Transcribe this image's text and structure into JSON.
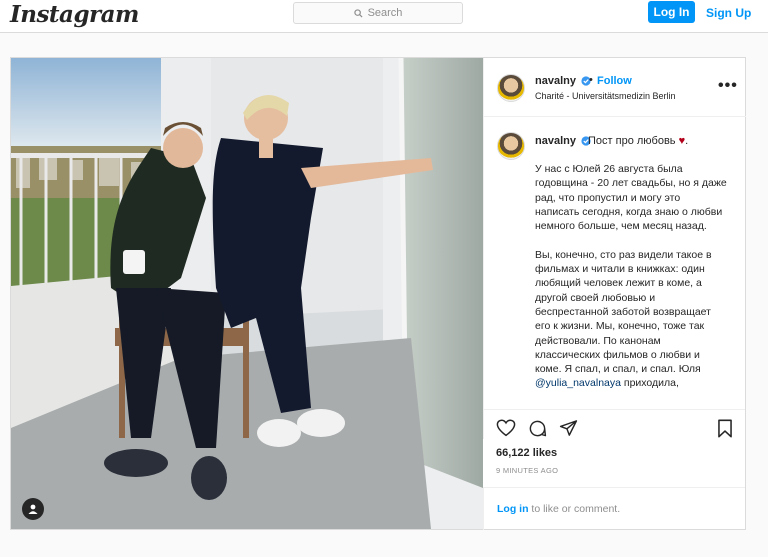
{
  "header": {
    "logo": "Instagram",
    "search_placeholder": "Search",
    "login_label": "Log In",
    "signup_label": "Sign Up"
  },
  "post": {
    "username": "navalny",
    "follow_label": "Follow",
    "separator": "•",
    "location": "Charité - Universitätsmedizin Berlin",
    "more_label": "•••",
    "caption_first": "Пост про любовь",
    "caption_heart": "♥",
    "caption_part1": "У нас с Юлей 26 августа была годовщина - 20 лет свадьбы, но я даже рад, что пропустил и могу это написать сегодня, когда знаю о любви немного больше, чем месяц назад.\n\nВы, конечно, сто раз видели такое в фильмах и читали в книжках: один любящий человек лежит в коме, а другой своей любовью и беспрестанной заботой возвращает его к жизни. Мы, конечно, тоже так действовали. По канонам классических фильмов о любви и коме. Я спал, и спал, и спал. Юля ",
    "caption_mention": "@yulia_navalnaya",
    "caption_part2": " приходила,",
    "likes": "66,122 likes",
    "time": "9 MINUTES AGO",
    "footer_login": "Log in",
    "footer_rest": " to like or comment."
  },
  "colors": {
    "accent": "#0095f6",
    "border": "#dbdbdb",
    "muted": "#8e8e8e",
    "text": "#262626"
  },
  "icons": [
    "search-icon",
    "verified-icon",
    "more-icon",
    "heart-icon",
    "comment-icon",
    "share-icon",
    "bookmark-icon",
    "tagged-user-icon"
  ]
}
